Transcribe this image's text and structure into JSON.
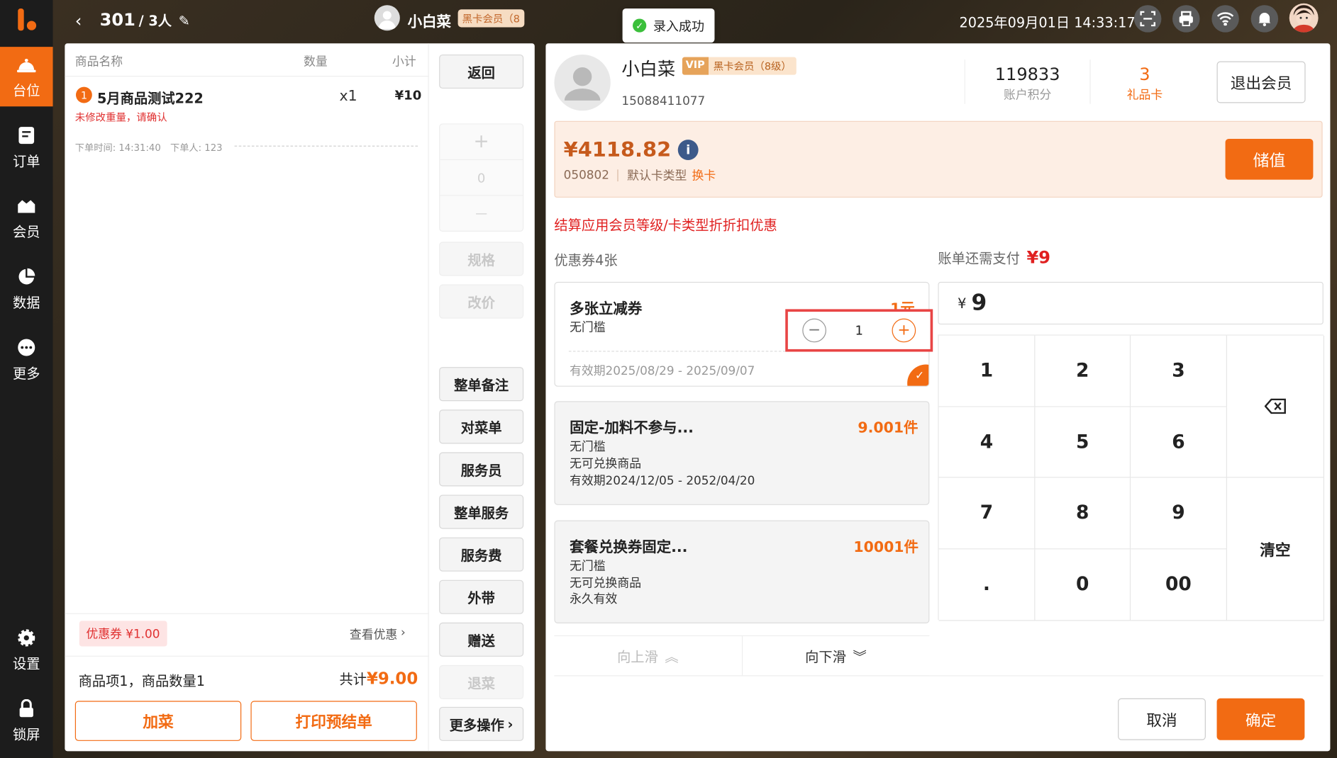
{
  "toast": "录入成功",
  "topbar": {
    "table_no": "301",
    "guests": "/ 3人",
    "member_name": "小白菜",
    "member_badge": "黑卡会员（8",
    "datetime": "2025年09月01日 14:33:17"
  },
  "sidebar": {
    "items": [
      {
        "label": "台位",
        "icon": "table-bell-icon"
      },
      {
        "label": "订单",
        "icon": "order-icon"
      },
      {
        "label": "会员",
        "icon": "member-icon"
      },
      {
        "label": "数据",
        "icon": "pie-chart-icon"
      },
      {
        "label": "更多",
        "icon": "more-icon"
      },
      {
        "label": "设置",
        "icon": "gear-icon"
      },
      {
        "label": "锁屏",
        "icon": "lock-icon"
      }
    ]
  },
  "order": {
    "headers": {
      "name": "商品名称",
      "qty": "数量",
      "subtotal": "小计"
    },
    "item": {
      "index": "1",
      "name": "5月商品测试222",
      "qty": "x1",
      "price": "¥10",
      "warning": "未修改重量，请确认"
    },
    "meta": "下单时间: 14:31:40　下单人: 123",
    "coupon_tag": "优惠券 ¥1.00",
    "view_discount": "查看优惠",
    "summary": "商品项1，商品数量1",
    "total_label": "共计",
    "total_value": "¥9.00",
    "add_dish": "加菜",
    "print_pre": "打印预结单"
  },
  "side_buttons": {
    "back": "返回",
    "plus": "+",
    "zero": "0",
    "minus": "—",
    "spec": "规格",
    "price_change": "改价",
    "whole_note": "整单备注",
    "check_menu": "对菜单",
    "waiter": "服务员",
    "whole_service": "整单服务",
    "service_fee": "服务费",
    "takeout": "外带",
    "gift": "赠送",
    "return_dish": "退菜",
    "more_ops": "更多操作"
  },
  "member": {
    "name": "小白菜",
    "vip": "VIP",
    "level": "黑卡会员（8级）",
    "phone": "15088411077",
    "points": "119833",
    "points_label": "账户积分",
    "gift_cards": "3",
    "gift_cards_label": "礼品卡",
    "logout": "退出会员",
    "balance": "¥4118.82",
    "card_no": "050802",
    "card_type": "默认卡类型",
    "change_card": "换卡",
    "recharge": "储值"
  },
  "notice": "结算应用会员等级/卡类型折折扣优惠",
  "coupons": {
    "count_label": "优惠券4张",
    "due_label": "账单还需支付",
    "due_value": "¥9",
    "list": [
      {
        "title": "多张立减券",
        "amount": "1元",
        "threshold": "无门槛",
        "validity": "有效期2025/08/29 - 2025/09/07",
        "qty": "1"
      },
      {
        "title": "固定-加料不参与...",
        "amount": "9.001件",
        "threshold": "无门槛",
        "note": "无可兑换商品",
        "validity": "有效期2024/12/05 - 2052/04/20"
      },
      {
        "title": "套餐兑换券固定...",
        "amount": "10001件",
        "threshold": "无门槛",
        "note": "无可兑换商品",
        "validity": "永久有效"
      }
    ],
    "scroll_up": "向上滑",
    "scroll_down": "向下滑"
  },
  "pay": {
    "currency": "¥",
    "amount": "9",
    "keys": [
      "1",
      "2",
      "3",
      "4",
      "5",
      "6",
      "7",
      "8",
      "9",
      ".",
      "0",
      "00"
    ],
    "clear": "清空",
    "cancel": "取消",
    "confirm": "确定"
  }
}
